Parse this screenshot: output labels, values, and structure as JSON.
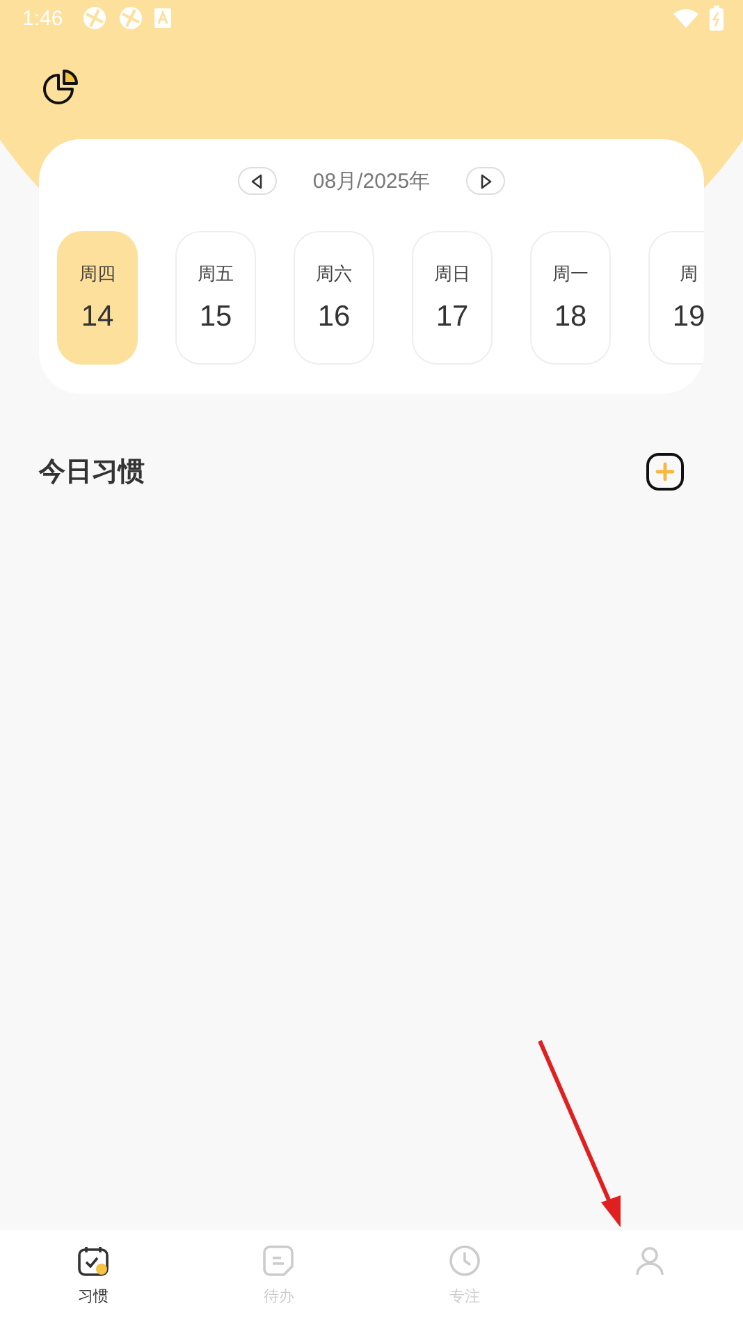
{
  "status_bar": {
    "time": "1:46"
  },
  "calendar": {
    "month": "08月/2025年",
    "days": [
      {
        "weekday": "周四",
        "date": "14",
        "selected": true
      },
      {
        "weekday": "周五",
        "date": "15",
        "selected": false
      },
      {
        "weekday": "周六",
        "date": "16",
        "selected": false
      },
      {
        "weekday": "周日",
        "date": "17",
        "selected": false
      },
      {
        "weekday": "周一",
        "date": "18",
        "selected": false
      },
      {
        "weekday": "周",
        "date": "19",
        "selected": false
      }
    ]
  },
  "section": {
    "title": "今日习惯"
  },
  "tabs": [
    {
      "kind": "habit",
      "label": "习惯",
      "selected": true
    },
    {
      "kind": "todo",
      "label": "待办",
      "selected": false
    },
    {
      "kind": "focus",
      "label": "专注",
      "selected": false
    },
    {
      "kind": "profile",
      "selected": false
    }
  ]
}
